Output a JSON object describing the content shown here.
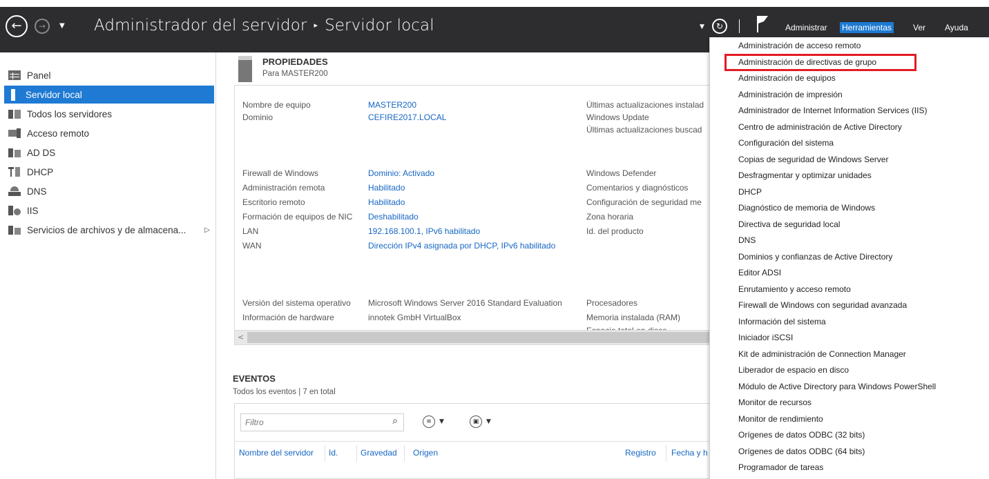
{
  "titlebar": {
    "app": "Administrador del servidor",
    "separator": "▸",
    "page": "Servidor local",
    "menus": [
      "Administrar",
      "Herramientas",
      "Ver",
      "Ayuda"
    ]
  },
  "sidebar": {
    "items": [
      {
        "label": "Panel",
        "icon": "dashboard-icon"
      },
      {
        "label": "Servidor local",
        "icon": "server-icon",
        "active": true
      },
      {
        "label": "Todos los servidores",
        "icon": "servers-icon"
      },
      {
        "label": "Acceso remoto",
        "icon": "remote-access-icon"
      },
      {
        "label": "AD DS",
        "icon": "ad-ds-icon"
      },
      {
        "label": "DHCP",
        "icon": "dhcp-icon"
      },
      {
        "label": "DNS",
        "icon": "dns-icon"
      },
      {
        "label": "IIS",
        "icon": "iis-icon"
      },
      {
        "label": "Servicios de archivos y de almacena...",
        "icon": "file-services-icon",
        "expand": "▷"
      }
    ]
  },
  "properties": {
    "title": "PROPIEDADES",
    "subtitle": "Para MASTER200",
    "left": [
      {
        "label": "Nombre de equipo",
        "value": "MASTER200"
      },
      {
        "label": "Dominio",
        "value": "CEFIRE2017.LOCAL"
      },
      {
        "label": "Firewall de Windows",
        "value": "Dominio: Activado"
      },
      {
        "label": "Administración remota",
        "value": "Habilitado"
      },
      {
        "label": "Escritorio remoto",
        "value": "Habilitado"
      },
      {
        "label": "Formación de equipos de NIC",
        "value": "Deshabilitado"
      },
      {
        "label": "LAN",
        "value": "192.168.100.1, IPv6 habilitado"
      },
      {
        "label": "WAN",
        "value": "Dirección IPv4 asignada por DHCP, IPv6 habilitado"
      },
      {
        "label": "Versión del sistema operativo",
        "value": "Microsoft Windows Server 2016 Standard Evaluation"
      },
      {
        "label": "Información de hardware",
        "value": "innotek GmbH VirtualBox"
      }
    ],
    "right": [
      "Últimas actualizaciones instalad",
      "Windows Update",
      "Últimas actualizaciones buscad",
      "Windows Defender",
      "Comentarios y diagnósticos",
      "Configuración de seguridad me",
      "Zona horaria",
      "Id. del producto",
      "Procesadores",
      "Memoria instalada (RAM)",
      "Espacio total en disco"
    ],
    "scroll_left": "<"
  },
  "events": {
    "title": "EVENTOS",
    "subtitle": "Todos los eventos | 7 en total",
    "filter_placeholder": "Filtro",
    "columns": [
      "Nombre del servidor",
      "Id.",
      "Gravedad",
      "Origen",
      "Registro",
      "Fecha y h"
    ]
  },
  "tools_menu": {
    "items": [
      "Administración de acceso remoto",
      "Administración de directivas de grupo",
      "Administración de equipos",
      "Administración de impresión",
      "Administrador de Internet Information Services (IIS)",
      "Centro de administración de Active Directory",
      "Configuración del sistema",
      "Copias de seguridad de Windows Server",
      "Desfragmentar y optimizar unidades",
      "DHCP",
      "Diagnóstico de memoria de Windows",
      "Directiva de seguridad local",
      "DNS",
      "Dominios y confianzas de Active Directory",
      "Editor ADSI",
      "Enrutamiento y acceso remoto",
      "Firewall de Windows con seguridad avanzada",
      "Información del sistema",
      "Iniciador iSCSI",
      "Kit de administración de Connection Manager",
      "Liberador de espacio en disco",
      "Módulo de Active Directory para Windows PowerShell",
      "Monitor de recursos",
      "Monitor de rendimiento",
      "Orígenes de datos ODBC (32 bits)",
      "Orígenes de datos ODBC (64 bits)",
      "Programador de tareas"
    ],
    "highlighted_index": 1,
    "highlight_color": "#e31b23"
  },
  "colors": {
    "titlebar": "#2d2d30",
    "accent": "#1e7ad2",
    "link": "#1666c4"
  }
}
